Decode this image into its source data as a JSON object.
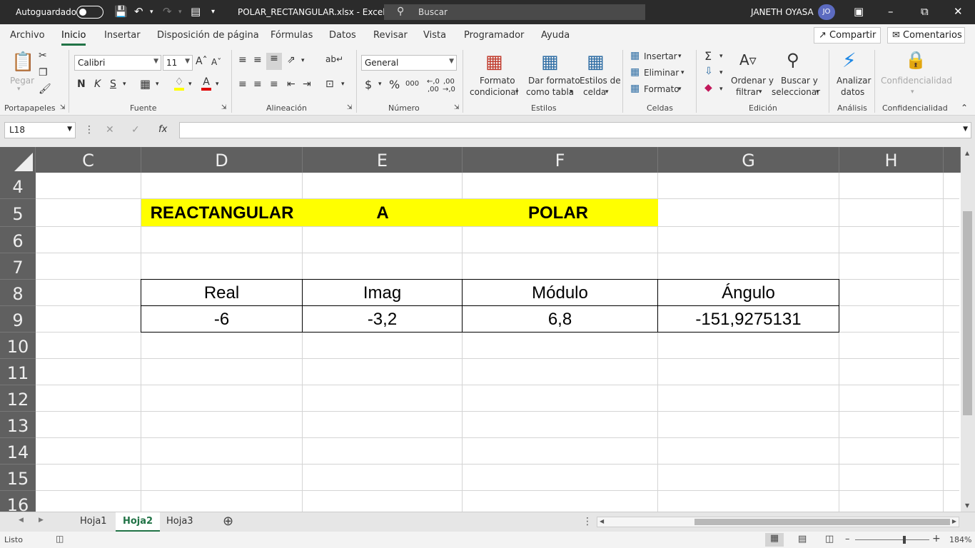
{
  "titlebar": {
    "autosave_label": "Autoguardado",
    "file_title": "POLAR_RECTANGULAR.xlsx  -  Excel",
    "search_placeholder": "Buscar",
    "user_name": "JANETH OYASA",
    "user_initials": "JO"
  },
  "ribbon_tabs": [
    "Archivo",
    "Inicio",
    "Insertar",
    "Disposición de página",
    "Fórmulas",
    "Datos",
    "Revisar",
    "Vista",
    "Programador",
    "Ayuda"
  ],
  "active_tab": "Inicio",
  "share_label": "Compartir",
  "comments_label": "Comentarios",
  "ribbon": {
    "paste_label": "Pegar",
    "font_name": "Calibri",
    "font_size": "11",
    "bold": "N",
    "italic": "K",
    "underline": "S",
    "number_format": "General",
    "currency": "$",
    "percent": "%",
    "thousands": "000",
    "cond_format": [
      "Formato",
      "condicional"
    ],
    "format_table": [
      "Dar formato",
      "como tabla"
    ],
    "cell_styles": [
      "Estilos de",
      "celda"
    ],
    "insert": "Insertar",
    "delete": "Eliminar",
    "format": "Formato",
    "sort_filter": [
      "Ordenar y",
      "filtrar"
    ],
    "find_select": [
      "Buscar y",
      "seleccionar"
    ],
    "analyze": [
      "Analizar",
      "datos"
    ],
    "confidential": "Confidencialidad",
    "groups": {
      "clipboard": "Portapapeles",
      "font": "Fuente",
      "alignment": "Alineación",
      "number": "Número",
      "styles": "Estilos",
      "cells": "Celdas",
      "editing": "Edición",
      "analysis": "Análisis",
      "confidentiality": "Confidencialidad"
    }
  },
  "formula_bar": {
    "name_box": "L18",
    "formula": ""
  },
  "columns": [
    "C",
    "D",
    "E",
    "F",
    "G",
    "H"
  ],
  "rows": [
    "4",
    "5",
    "6",
    "7",
    "8",
    "9",
    "10",
    "11",
    "12",
    "13",
    "14",
    "15",
    "16"
  ],
  "cells": {
    "title_d5": "REACTANGULAR",
    "title_e5": "A",
    "title_f5": "POLAR",
    "header_real": "Real",
    "header_imag": "Imag",
    "header_modulo": "Módulo",
    "header_angulo": "Ángulo",
    "val_real": "-6",
    "val_imag": "-3,2",
    "val_modulo": "6,8",
    "val_angulo": "-151,9275131"
  },
  "sheets": [
    "Hoja1",
    "Hoja2",
    "Hoja3"
  ],
  "active_sheet": "Hoja2",
  "status": {
    "ready": "Listo",
    "zoom": "184%"
  },
  "colors": {
    "accent": "#217346",
    "highlight": "#ffff00"
  }
}
